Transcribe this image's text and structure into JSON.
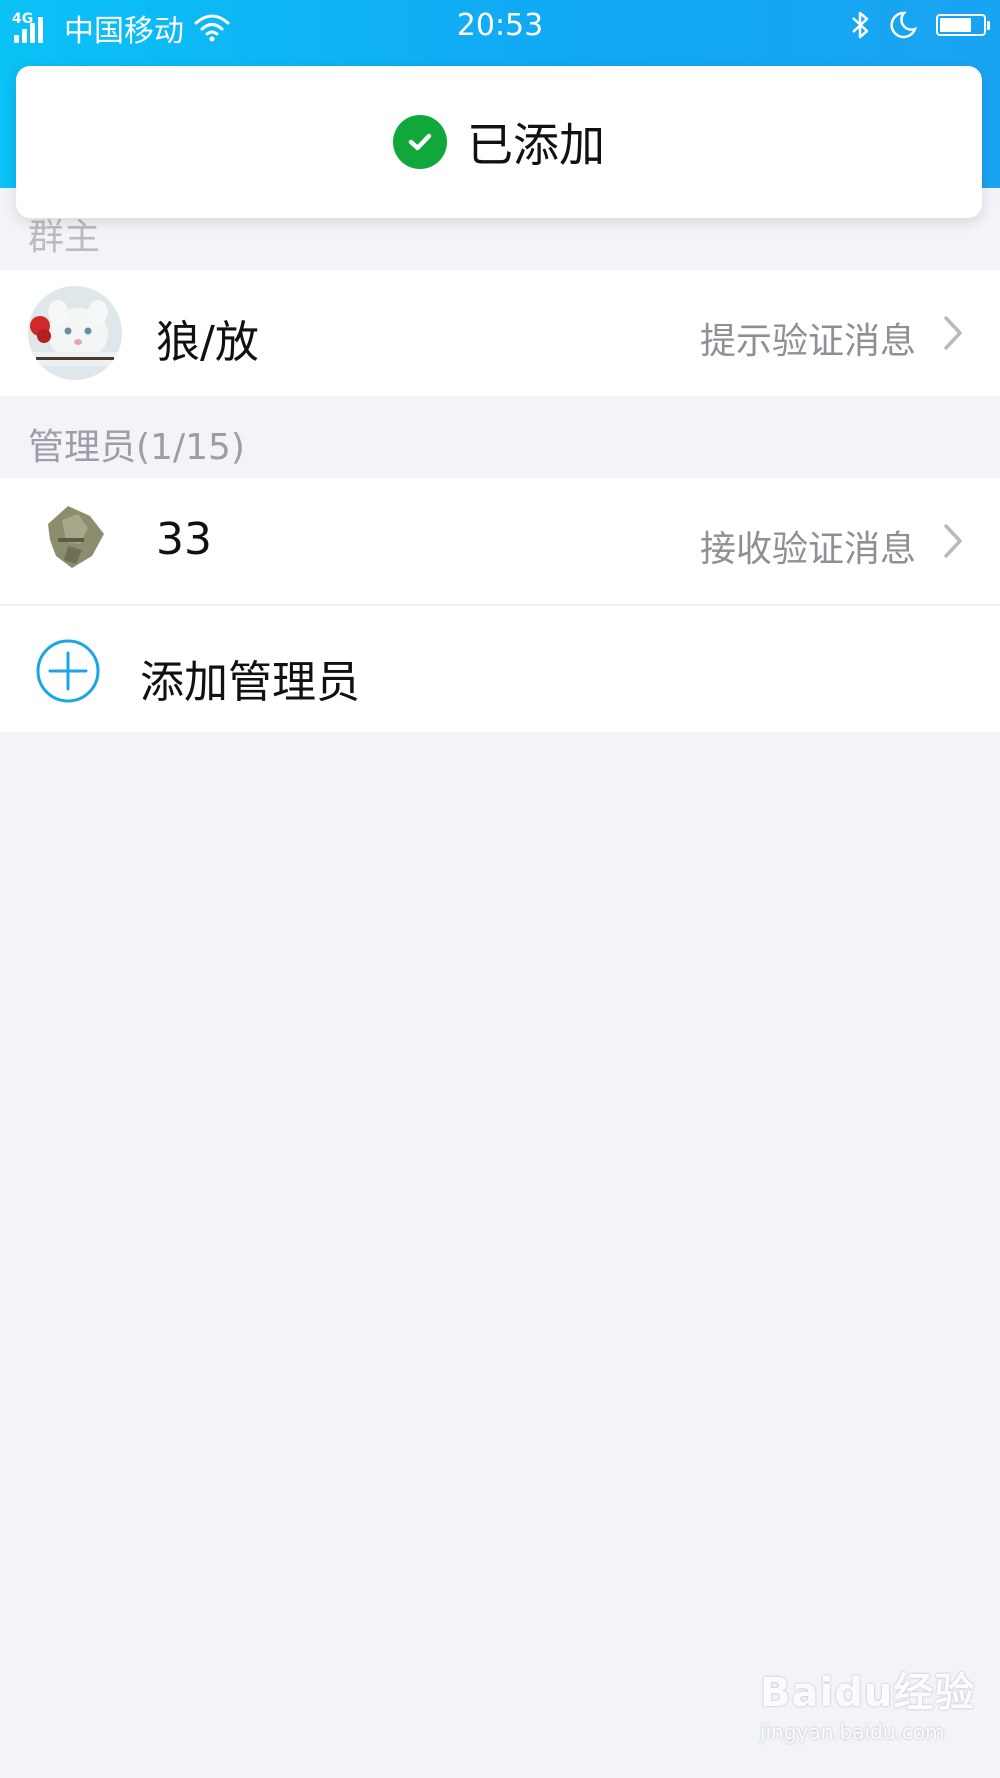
{
  "status_bar": {
    "network": "4G",
    "carrier": "中国移动",
    "time": "20:53",
    "battery_level": 0.75
  },
  "toast": {
    "message": "已添加",
    "icon": "check-circle-icon",
    "icon_color": "#10a83a"
  },
  "owner_section": {
    "header": "群主",
    "member": {
      "name": "狼/放",
      "action_label": "提示验证消息"
    }
  },
  "admin_section": {
    "header": "管理员(1/15)",
    "members": [
      {
        "name": "33",
        "action_label": "接收验证消息"
      }
    ],
    "add_button_label": "添加管理员"
  },
  "watermark": {
    "brand": "Baidu经验",
    "url": "jingyan.baidu.com"
  },
  "colors": {
    "header_blue": "#11a9f4",
    "accent_blue": "#1aa6e6",
    "background": "#f2f4f8"
  }
}
